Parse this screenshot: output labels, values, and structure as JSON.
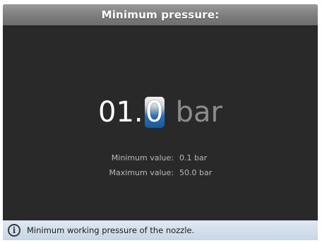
{
  "header": {
    "title": "Minimum pressure:"
  },
  "editor": {
    "digits_prefix": "01.",
    "cursor_digit": "0",
    "unit": "bar"
  },
  "limits": {
    "min_label": "Minimum value:",
    "min_value": "0.1 bar",
    "max_label": "Maximum value:",
    "max_value": "50.0 bar"
  },
  "info": {
    "icon": "info-icon",
    "text": "Minimum working pressure of the nozzle."
  },
  "colors": {
    "background": "#2a2929",
    "cursor_highlight": "#2e6fb0",
    "info_bar": "#c7d6e6"
  }
}
